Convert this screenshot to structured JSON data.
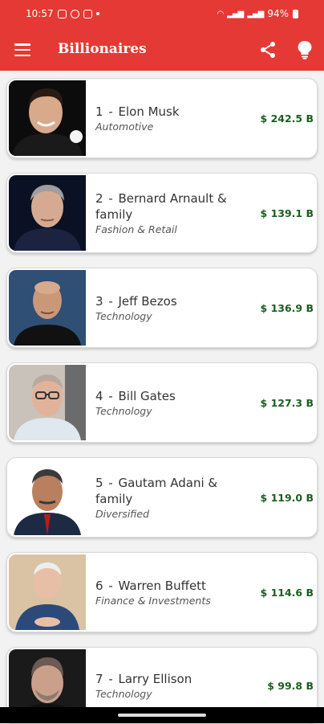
{
  "status": {
    "time": "10:57",
    "battery": "94%"
  },
  "app": {
    "title": "Billionaires"
  },
  "colors": {
    "accent": "#e53935",
    "networth": "#1b5e20"
  },
  "icons": [
    "menu-icon",
    "share-icon",
    "lightbulb-icon"
  ],
  "billionaires": [
    {
      "rank": "1",
      "name": "Elon Musk",
      "industry": "Automotive",
      "net_worth": "$ 242.5 B"
    },
    {
      "rank": "2",
      "name": "Bernard Arnault & family",
      "industry": "Fashion & Retail",
      "net_worth": "$ 139.1 B"
    },
    {
      "rank": "3",
      "name": "Jeff Bezos",
      "industry": "Technology",
      "net_worth": "$ 136.9 B"
    },
    {
      "rank": "4",
      "name": "Bill Gates",
      "industry": "Technology",
      "net_worth": "$ 127.3 B"
    },
    {
      "rank": "5",
      "name": "Gautam Adani & family",
      "industry": "Diversified",
      "net_worth": "$ 119.0 B"
    },
    {
      "rank": "6",
      "name": "Warren Buffett",
      "industry": "Finance & Investments",
      "net_worth": "$ 114.6 B"
    },
    {
      "rank": "7",
      "name": "Larry Ellison",
      "industry": "Technology",
      "net_worth": "$ 99.8 B"
    }
  ]
}
